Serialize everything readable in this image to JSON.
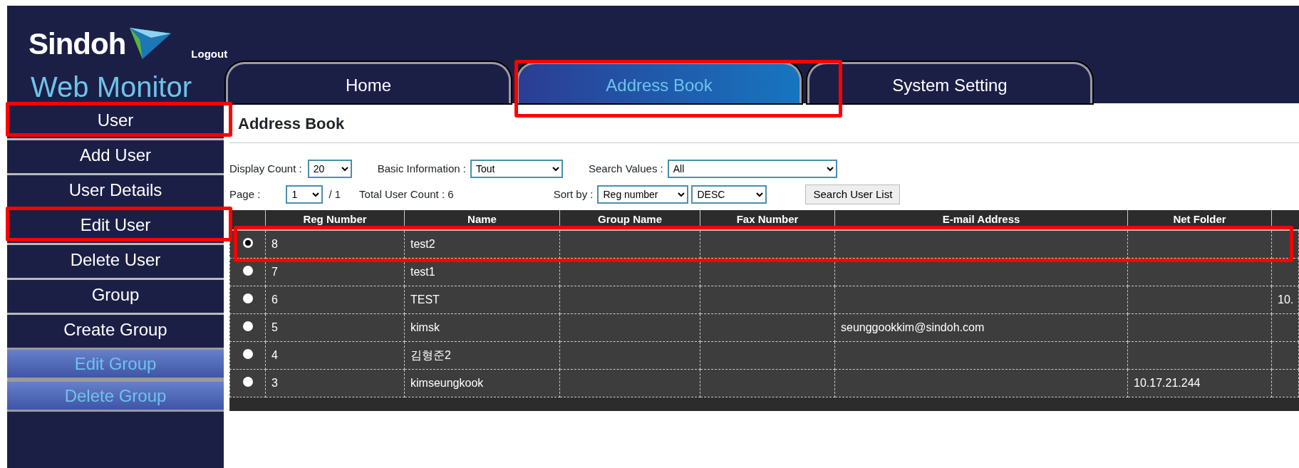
{
  "header": {
    "logo_text": "Sindoh",
    "product": "Web Monitor",
    "logout": "Logout"
  },
  "tabs": [
    {
      "label": "Home",
      "selected": false,
      "highlighted": false
    },
    {
      "label": "Address Book",
      "selected": true,
      "highlighted": true
    },
    {
      "label": "System Setting",
      "selected": false,
      "highlighted": false
    }
  ],
  "sidebar": {
    "items": [
      {
        "label": "User",
        "disabled": false,
        "highlighted": true
      },
      {
        "label": "Add User",
        "disabled": false,
        "highlighted": false
      },
      {
        "label": "User Details",
        "disabled": false,
        "highlighted": false
      },
      {
        "label": "Edit User",
        "disabled": false,
        "highlighted": true
      },
      {
        "label": "Delete User",
        "disabled": false,
        "highlighted": false
      },
      {
        "label": "Group",
        "disabled": false,
        "highlighted": false
      },
      {
        "label": "Create Group",
        "disabled": false,
        "highlighted": false
      },
      {
        "label": "Edit Group",
        "disabled": true,
        "highlighted": false
      },
      {
        "label": "Delete Group",
        "disabled": true,
        "highlighted": false
      }
    ]
  },
  "page_title": "Address Book",
  "filters": {
    "display_count_label": "Display Count :",
    "display_count": "20",
    "basic_info_label": "Basic Information :",
    "basic_info": "Tout",
    "search_values_label": "Search Values :",
    "search_values": "All",
    "page_label": "Page :",
    "page": "1",
    "page_total": "/ 1",
    "total_user_count": "Total User Count : 6",
    "sort_by_label": "Sort by :",
    "sort_by": "Reg number",
    "sort_order": "DESC",
    "search_button": "Search User List"
  },
  "table": {
    "columns": [
      "Reg Number",
      "Name",
      "Group Name",
      "Fax Number",
      "E-mail Address",
      "Net Folder"
    ],
    "rows": [
      {
        "selected": true,
        "highlighted": true,
        "cells": [
          "8",
          "test2",
          "",
          "",
          "",
          "",
          ""
        ]
      },
      {
        "selected": false,
        "highlighted": false,
        "cells": [
          "7",
          "test1",
          "",
          "",
          "",
          "",
          ""
        ]
      },
      {
        "selected": false,
        "highlighted": false,
        "cells": [
          "6",
          "TEST",
          "",
          "",
          "",
          "",
          "10."
        ]
      },
      {
        "selected": false,
        "highlighted": false,
        "cells": [
          "5",
          "kimsk",
          "",
          "",
          "seunggookkim@sindoh.com",
          "",
          ""
        ]
      },
      {
        "selected": false,
        "highlighted": false,
        "cells": [
          "4",
          "김형준2",
          "",
          "",
          "",
          "",
          ""
        ]
      },
      {
        "selected": false,
        "highlighted": false,
        "cells": [
          "3",
          "kimseungkook",
          "",
          "",
          "",
          "10.17.21.244",
          ""
        ]
      }
    ]
  }
}
